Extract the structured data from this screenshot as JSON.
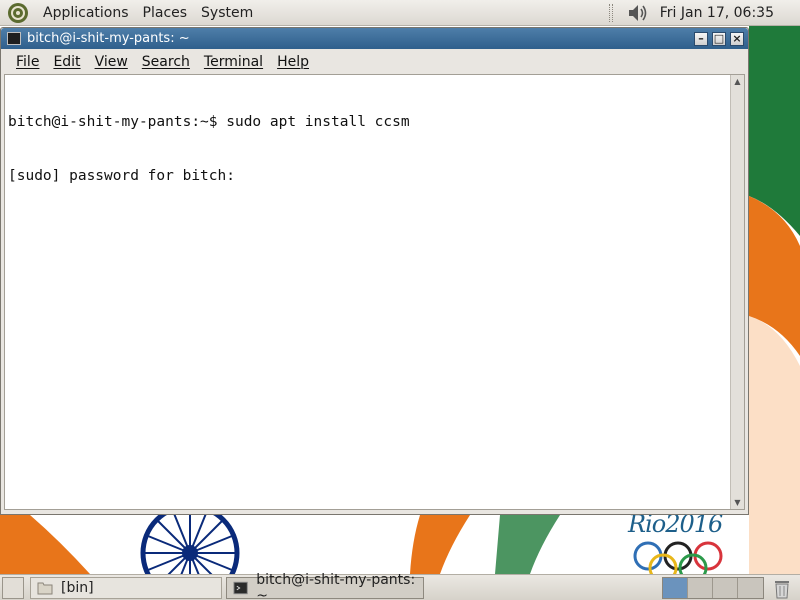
{
  "top_panel": {
    "menus": [
      "Applications",
      "Places",
      "System"
    ],
    "clock": "Fri Jan 17, 06:35",
    "icons": {
      "distro": "ubuntu-logo-icon",
      "volume": "volume-icon"
    }
  },
  "window": {
    "title": "bitch@i-shit-my-pants: ~",
    "controls": {
      "minimize": "–",
      "maximize": "□",
      "close": "×"
    },
    "menu": [
      "File",
      "Edit",
      "View",
      "Search",
      "Terminal",
      "Help"
    ]
  },
  "terminal": {
    "lines": [
      "bitch@i-shit-my-pants:~$ sudo apt install ccsm",
      "[sudo] password for bitch:"
    ]
  },
  "wallpaper": {
    "text": "Rio2016"
  },
  "taskbar": {
    "tasks": [
      {
        "label": "[bin]",
        "icon": "folder-icon",
        "active": false
      },
      {
        "label": "bitch@i-shit-my-pants: ~",
        "icon": "terminal-icon",
        "active": true
      }
    ],
    "workspaces": 4,
    "active_workspace": 1,
    "trash_icon": "trash-icon"
  },
  "colors": {
    "titlebar": "#3a6a97",
    "panel": "#e4e0da",
    "flag_orange": "#e8751a",
    "flag_green": "#1f7a3a",
    "chakra_blue": "#0a2a7a"
  }
}
